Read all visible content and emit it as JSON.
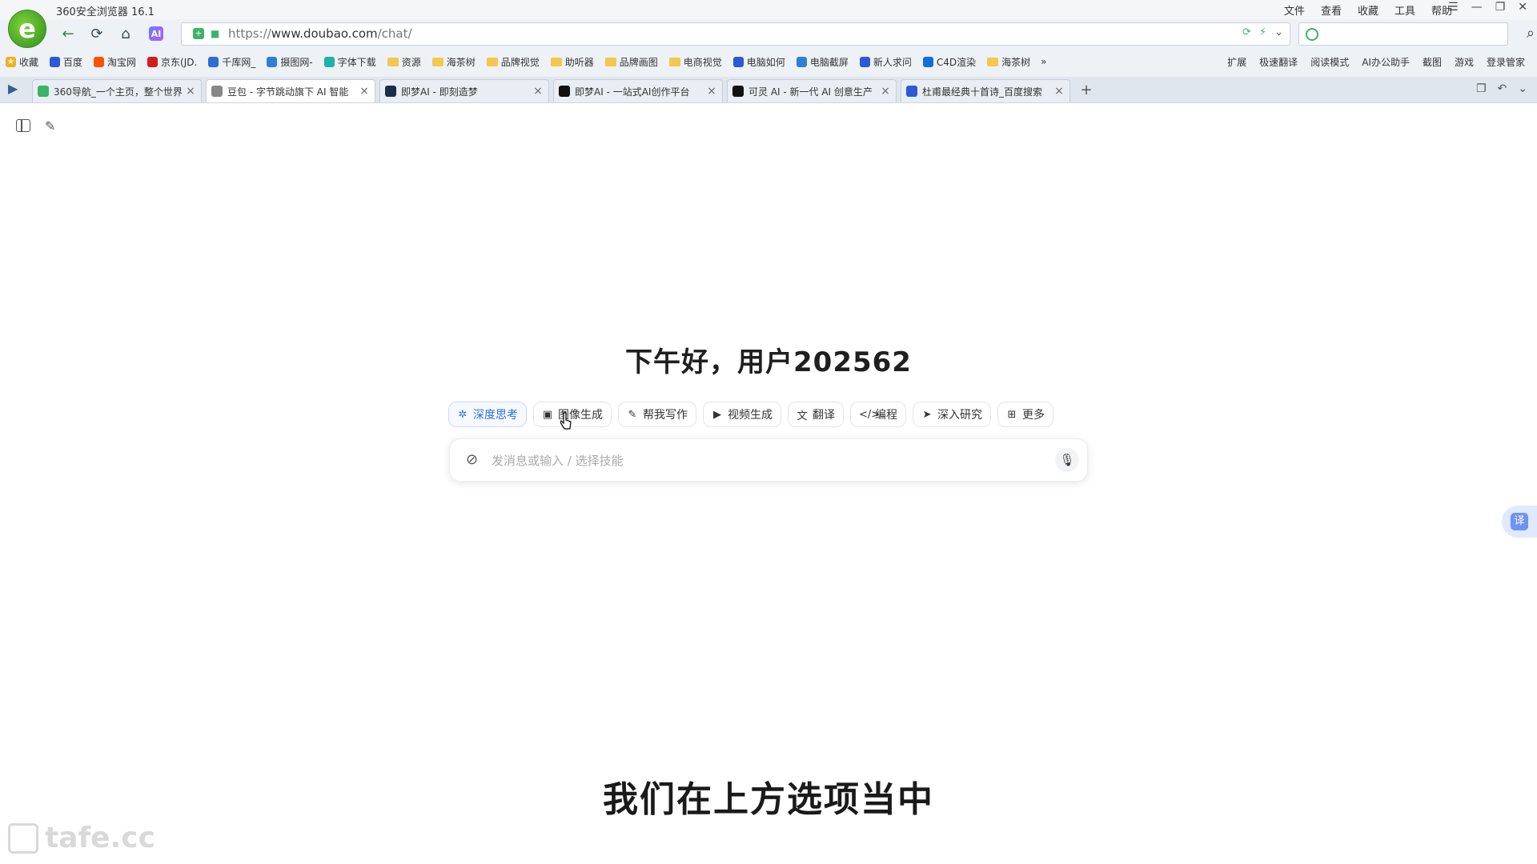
{
  "browser": {
    "title": "360安全浏览器 16.1",
    "logo_glyph": "e",
    "menu": [
      "文件",
      "查看",
      "收藏",
      "工具",
      "帮助"
    ],
    "window_controls": [
      "☰",
      "—",
      "❐",
      "✕"
    ],
    "nav": {
      "back": "←",
      "refresh": "⟳",
      "home": "⌂",
      "ai": "AI"
    },
    "url": {
      "scheme": "https://",
      "host": "www.doubao.com",
      "path": "/chat/"
    },
    "search_placeholder": "",
    "bookmarks": [
      {
        "label": "收藏",
        "icon": "star-icon",
        "color": "#f2b01e"
      },
      {
        "label": "百度",
        "icon": "baidu-icon",
        "color": "#2f58d8"
      },
      {
        "label": "淘宝网",
        "icon": "taobao-icon",
        "color": "#ff5000"
      },
      {
        "label": "京东(JD.",
        "icon": "jd-icon",
        "color": "#d71a1a"
      },
      {
        "label": "千库网_",
        "icon": "qianku-icon",
        "color": "#2b6fd6"
      },
      {
        "label": "摄图网-",
        "icon": "shetu-icon",
        "color": "#2e7fd8"
      },
      {
        "label": "字体下载",
        "icon": "font-icon",
        "color": "#1bb3a4"
      },
      {
        "label": "资源",
        "icon": "folder-icon",
        "color": "#f2c94c"
      },
      {
        "label": "海茶树",
        "icon": "folder-icon",
        "color": "#f2c94c"
      },
      {
        "label": "品牌视觉",
        "icon": "folder-icon",
        "color": "#f2c94c"
      },
      {
        "label": "助听器",
        "icon": "folder-icon",
        "color": "#f2c94c"
      },
      {
        "label": "品牌画图",
        "icon": "folder-icon",
        "color": "#f2c94c"
      },
      {
        "label": "电商视觉",
        "icon": "folder-icon",
        "color": "#f2c94c"
      },
      {
        "label": "电脑如何",
        "icon": "baidu-icon",
        "color": "#2f58d8"
      },
      {
        "label": "电脑截屏",
        "icon": "edge-icon",
        "color": "#2d7fd3"
      },
      {
        "label": "新人求问",
        "icon": "baidu-icon",
        "color": "#2f58d8"
      },
      {
        "label": "C4D渲染",
        "icon": "zhihu-icon",
        "color": "#0f6fde"
      },
      {
        "label": "海茶树",
        "icon": "folder-icon",
        "color": "#f2c94c"
      }
    ],
    "bookmarks_more": "»",
    "bookmarks_right": [
      "扩展",
      "极速翻译",
      "阅读模式",
      "AI办公助手",
      "截图",
      "游戏",
      "登录管家"
    ],
    "tabs": [
      {
        "label": "360导航_一个主页，整个世界",
        "icon": "360-icon",
        "color": "#3bb36a"
      },
      {
        "label": "豆包 - 字节跳动旗下 AI 智能",
        "icon": "doubao-icon",
        "color": "#888888",
        "active": true
      },
      {
        "label": "即梦AI - 即刻造梦",
        "icon": "jimeng-icon",
        "color": "#1c2b4a"
      },
      {
        "label": "即梦AI - 一站式AI创作平台",
        "icon": "jimeng-icon",
        "color": "#111111"
      },
      {
        "label": "可灵 AI - 新一代 AI 创意生产",
        "icon": "kling-icon",
        "color": "#111111"
      },
      {
        "label": "杜甫最经典十首诗_百度搜索",
        "icon": "baidu-icon",
        "color": "#2f58d8"
      }
    ],
    "new_tab": "+"
  },
  "page": {
    "greeting": "下午好，用户202562",
    "skills": [
      {
        "label": "深度思考",
        "icon": "deep-think-icon",
        "glyph": "✲",
        "active": true
      },
      {
        "label": "图像生成",
        "icon": "image-icon",
        "glyph": "▣"
      },
      {
        "label": "帮我写作",
        "icon": "write-icon",
        "glyph": "✎"
      },
      {
        "label": "视频生成",
        "icon": "video-icon",
        "glyph": "▶"
      },
      {
        "label": "翻译",
        "icon": "translate-icon",
        "glyph": "文"
      },
      {
        "label": "编程",
        "icon": "code-icon",
        "glyph": "</>"
      },
      {
        "label": "深入研究",
        "icon": "research-icon",
        "glyph": "➤"
      },
      {
        "label": "更多",
        "icon": "grid-icon",
        "glyph": "⊞"
      }
    ],
    "chat_placeholder": "发消息或输入 / 选择技能",
    "translate_float": "译"
  },
  "overlay": {
    "subtitle": "我们在上方选项当中",
    "watermark": "tafe.cc"
  },
  "colors": {
    "accent": "#2f6fe0",
    "chrome": "#eef1f5"
  }
}
